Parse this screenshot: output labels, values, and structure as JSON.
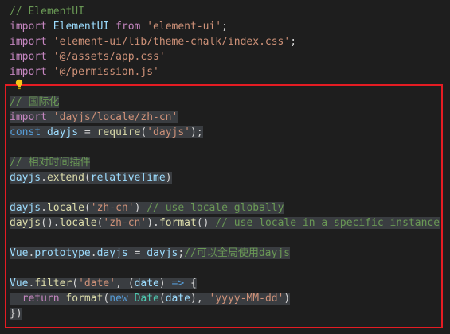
{
  "editor": {
    "lines": [
      {
        "tokens": [
          {
            "t": "// ElementUI",
            "c": "t-comment"
          }
        ]
      },
      {
        "tokens": [
          {
            "t": "import",
            "c": "t-keyword"
          },
          {
            "t": " ",
            "c": "t-plain"
          },
          {
            "t": "ElementUI",
            "c": "t-var"
          },
          {
            "t": " ",
            "c": "t-plain"
          },
          {
            "t": "from",
            "c": "t-keyword"
          },
          {
            "t": " ",
            "c": "t-plain"
          },
          {
            "t": "'element-ui'",
            "c": "t-string"
          },
          {
            "t": ";",
            "c": "t-plain"
          }
        ]
      },
      {
        "tokens": [
          {
            "t": "import",
            "c": "t-keyword"
          },
          {
            "t": " ",
            "c": "t-plain"
          },
          {
            "t": "'element-ui/lib/theme-chalk/index.css'",
            "c": "t-string"
          },
          {
            "t": ";",
            "c": "t-plain"
          }
        ]
      },
      {
        "tokens": [
          {
            "t": "import",
            "c": "t-keyword"
          },
          {
            "t": " ",
            "c": "t-plain"
          },
          {
            "t": "'@/assets/app.css'",
            "c": "t-string"
          }
        ]
      },
      {
        "tokens": [
          {
            "t": "import",
            "c": "t-keyword"
          },
          {
            "t": " ",
            "c": "t-plain"
          },
          {
            "t": "'@/permission.js'",
            "c": "t-string"
          }
        ]
      },
      {
        "tokens": []
      },
      {
        "sel": true,
        "tokens": [
          {
            "t": "// 国际化",
            "c": "t-comment"
          }
        ]
      },
      {
        "sel": true,
        "tokens": [
          {
            "t": "import",
            "c": "t-keyword"
          },
          {
            "t": " ",
            "c": "t-plain"
          },
          {
            "t": "'dayjs/locale/zh-cn'",
            "c": "t-string"
          }
        ]
      },
      {
        "sel": true,
        "tokens": [
          {
            "t": "const",
            "c": "t-storage"
          },
          {
            "t": " ",
            "c": "t-plain"
          },
          {
            "t": "dayjs",
            "c": "t-var"
          },
          {
            "t": " = ",
            "c": "t-plain"
          },
          {
            "t": "require",
            "c": "t-fn"
          },
          {
            "t": "(",
            "c": "t-paren"
          },
          {
            "t": "'dayjs'",
            "c": "t-string"
          },
          {
            "t": ");",
            "c": "t-plain"
          }
        ]
      },
      {
        "sel": true,
        "tokens": []
      },
      {
        "sel": true,
        "tokens": [
          {
            "t": "// 相对时间插件",
            "c": "t-comment"
          }
        ]
      },
      {
        "sel": true,
        "tokens": [
          {
            "t": "dayjs",
            "c": "t-var"
          },
          {
            "t": ".",
            "c": "t-plain"
          },
          {
            "t": "extend",
            "c": "t-fn"
          },
          {
            "t": "(",
            "c": "t-paren"
          },
          {
            "t": "relativeTime",
            "c": "t-var"
          },
          {
            "t": ")",
            "c": "t-paren"
          }
        ]
      },
      {
        "sel": true,
        "tokens": []
      },
      {
        "sel": true,
        "tokens": [
          {
            "t": "dayjs",
            "c": "t-var"
          },
          {
            "t": ".",
            "c": "t-plain"
          },
          {
            "t": "locale",
            "c": "t-fn"
          },
          {
            "t": "(",
            "c": "t-paren"
          },
          {
            "t": "'zh-cn'",
            "c": "t-string"
          },
          {
            "t": ") ",
            "c": "t-paren"
          },
          {
            "t": "// use locale globally",
            "c": "t-comment"
          }
        ]
      },
      {
        "sel": true,
        "tokens": [
          {
            "t": "dayjs",
            "c": "t-fn"
          },
          {
            "t": "().",
            "c": "t-plain"
          },
          {
            "t": "locale",
            "c": "t-fn"
          },
          {
            "t": "(",
            "c": "t-paren"
          },
          {
            "t": "'zh-cn'",
            "c": "t-string"
          },
          {
            "t": ").",
            "c": "t-plain"
          },
          {
            "t": "format",
            "c": "t-fn"
          },
          {
            "t": "() ",
            "c": "t-plain"
          },
          {
            "t": "// use locale in a specific instance",
            "c": "t-comment"
          }
        ]
      },
      {
        "sel": true,
        "tokens": []
      },
      {
        "sel": true,
        "tokens": [
          {
            "t": "Vue",
            "c": "t-var"
          },
          {
            "t": ".",
            "c": "t-plain"
          },
          {
            "t": "prototype",
            "c": "t-var"
          },
          {
            "t": ".",
            "c": "t-plain"
          },
          {
            "t": "dayjs",
            "c": "t-var"
          },
          {
            "t": " = ",
            "c": "t-plain"
          },
          {
            "t": "dayjs",
            "c": "t-var"
          },
          {
            "t": ";",
            "c": "t-plain"
          },
          {
            "t": "//可以全局使用dayjs",
            "c": "t-comment"
          }
        ]
      },
      {
        "sel": true,
        "tokens": []
      },
      {
        "sel": true,
        "tokens": [
          {
            "t": "Vue",
            "c": "t-var"
          },
          {
            "t": ".",
            "c": "t-plain"
          },
          {
            "t": "filter",
            "c": "t-fn"
          },
          {
            "t": "(",
            "c": "t-paren"
          },
          {
            "t": "'date'",
            "c": "t-string"
          },
          {
            "t": ", ",
            "c": "t-plain"
          },
          {
            "t": "(",
            "c": "t-paren"
          },
          {
            "t": "date",
            "c": "t-var"
          },
          {
            "t": ") ",
            "c": "t-paren"
          },
          {
            "t": "=>",
            "c": "t-storage"
          },
          {
            "t": " {",
            "c": "t-plain"
          }
        ]
      },
      {
        "sel": true,
        "tokens": [
          {
            "t": "  ",
            "c": "t-plain"
          },
          {
            "t": "return",
            "c": "t-keyword"
          },
          {
            "t": " ",
            "c": "t-plain"
          },
          {
            "t": "format",
            "c": "t-fn"
          },
          {
            "t": "(",
            "c": "t-paren"
          },
          {
            "t": "new",
            "c": "t-storage"
          },
          {
            "t": " ",
            "c": "t-plain"
          },
          {
            "t": "Date",
            "c": "t-class"
          },
          {
            "t": "(",
            "c": "t-paren"
          },
          {
            "t": "date",
            "c": "t-var"
          },
          {
            "t": "), ",
            "c": "t-paren"
          },
          {
            "t": "'yyyy-MM-dd'",
            "c": "t-string"
          },
          {
            "t": ")",
            "c": "t-paren"
          }
        ]
      },
      {
        "sel": true,
        "tokens": [
          {
            "t": "})",
            "c": "t-plain"
          }
        ]
      }
    ]
  },
  "highlight": {
    "color": "#e51c23"
  },
  "icons": {
    "lightbulb": "lightbulb-icon"
  }
}
